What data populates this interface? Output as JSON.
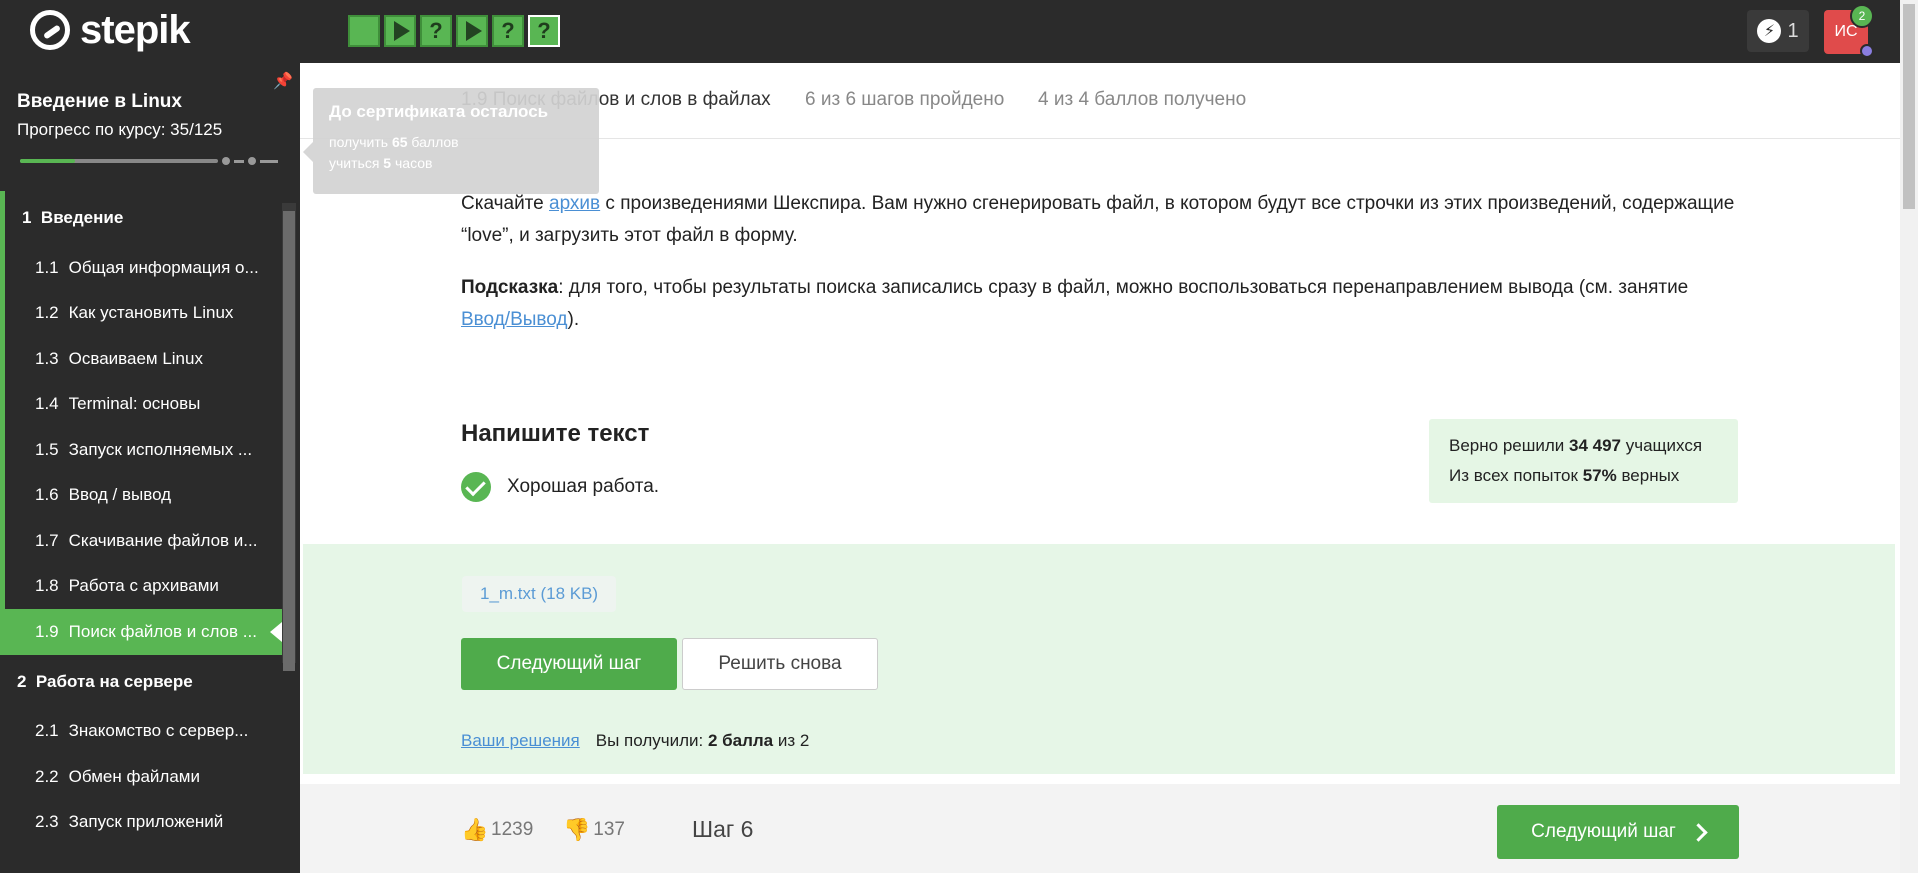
{
  "header": {
    "logo_text": "stepik",
    "steps": [
      {
        "type": "text",
        "symbol": ""
      },
      {
        "type": "video",
        "symbol": ""
      },
      {
        "type": "quiz",
        "symbol": "?"
      },
      {
        "type": "video",
        "symbol": ""
      },
      {
        "type": "quiz",
        "symbol": "?"
      },
      {
        "type": "quiz",
        "symbol": "?",
        "active": true
      }
    ],
    "streak_count": "1",
    "avatar_initials": "ИС",
    "notification_count": "2"
  },
  "sidebar": {
    "course_title": "Введение в Linux",
    "progress_label": "Прогресс по курсу:  35/125",
    "progress_fraction": 0.28,
    "modules": [
      {
        "number": "1",
        "title": "Введение",
        "items": [
          {
            "number": "1.1",
            "title": "Общая информация о..."
          },
          {
            "number": "1.2",
            "title": "Как установить Linux"
          },
          {
            "number": "1.3",
            "title": "Осваиваем Linux"
          },
          {
            "number": "1.4",
            "title": "Terminal: основы"
          },
          {
            "number": "1.5",
            "title": "Запуск исполняемых ..."
          },
          {
            "number": "1.6",
            "title": "Ввод / вывод"
          },
          {
            "number": "1.7",
            "title": "Скачивание файлов и..."
          },
          {
            "number": "1.8",
            "title": "Работа с архивами"
          },
          {
            "number": "1.9",
            "title": "Поиск файлов и слов ..."
          }
        ]
      },
      {
        "number": "2",
        "title": "Работа на сервере",
        "items": [
          {
            "number": "2.1",
            "title": "Знакомство с сервер..."
          },
          {
            "number": "2.2",
            "title": "Обмен файлами"
          },
          {
            "number": "2.3",
            "title": "Запуск приложений"
          }
        ]
      }
    ]
  },
  "tooltip": {
    "title": "До сертификата осталось",
    "line1_prefix": "получить ",
    "line1_value": "65",
    "line1_suffix": " баллов",
    "line2_prefix": "учиться ",
    "line2_value": "5",
    "line2_suffix": " часов"
  },
  "lesson": {
    "title": "1.9 Поиск файлов и слов в файлах",
    "steps_done": "6 из 6 шагов пройдено",
    "points": "4 из 4 баллов  получено"
  },
  "content": {
    "p1_before": "Скачайте ",
    "p1_link": "архив",
    "p1_after": " с произведениями Шекспира. Вам нужно сгенерировать файл, в котором будут все строчки из этих произведений, содержащие “love”, и загрузить этот файл в форму.",
    "p2_bold": "Подсказка",
    "p2_text": ": для того, чтобы результаты поиска записались сразу в файл, можно воспользоваться перенаправлением вывода (см. занятие ",
    "p2_link": "Ввод/Вывод",
    "p2_end": ")."
  },
  "task": {
    "heading": "Напишите текст",
    "success_text": "Хорошая работа.",
    "stats_line1_prefix": "Верно решили ",
    "stats_line1_value": "34 497",
    "stats_line1_suffix": " учащихся",
    "stats_line2_prefix": "Из всех попыток ",
    "stats_line2_value": "57%",
    "stats_line2_suffix": " верных",
    "file_label": "1_m.txt (18 KB)",
    "next_button": "Следующий шаг",
    "retry_button": "Решить снова",
    "solutions_link": "Ваши решения",
    "received_prefix": "Вы получили: ",
    "received_value": "2 балла",
    "received_suffix": " из 2"
  },
  "footer": {
    "likes": "1239",
    "dislikes": "137",
    "step_label": "Шаг 6",
    "next_button": "Следующий шаг"
  },
  "colors": {
    "brand_green": "#59b653",
    "topbar_bg": "#2b2b2b",
    "link_blue": "#4a8fd4",
    "avatar_red": "#e04b4b"
  }
}
